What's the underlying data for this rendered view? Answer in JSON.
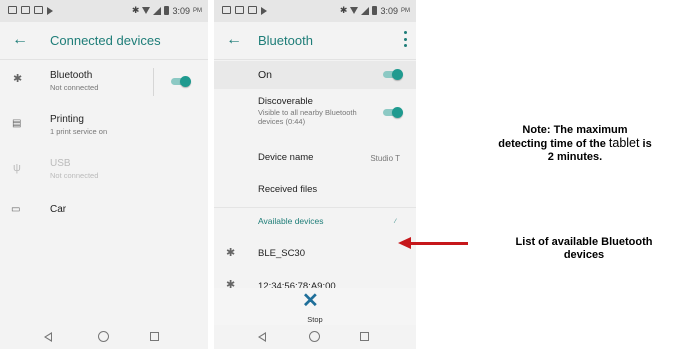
{
  "status_bar": {
    "time": "3:09",
    "ampm": "PM"
  },
  "screen1": {
    "title": "Connected devices",
    "items": [
      {
        "title": "Bluetooth",
        "subtitle": "Not connected",
        "icon": "bluetooth-icon",
        "toggle": true
      },
      {
        "title": "Printing",
        "subtitle": "1 print service on",
        "icon": "printer-icon"
      },
      {
        "title": "USB",
        "subtitle": "Not connected",
        "icon": "usb-icon",
        "disabled": true
      },
      {
        "title": "Car",
        "subtitle": "",
        "icon": "car-icon"
      }
    ]
  },
  "screen2": {
    "title": "Bluetooth",
    "on_label": "On",
    "discoverable_title": "Discoverable",
    "discoverable_sub": "Visible to all nearby Bluetooth devices (0:44)",
    "device_name_label": "Device name",
    "device_name_value": "Studio T",
    "received_files_label": "Received files",
    "available_devices_label": "Available devices",
    "devices": [
      "BLE_SC30",
      "12:34:56:78:A9:00"
    ],
    "stop_label": "Stop"
  },
  "notes": {
    "note1_line1": "Note: The maximum",
    "note1_line2_a": "detecting time of the ",
    "note1_line2_b": "tablet",
    "note1_line2_c": " is",
    "note1_line3": "2 minutes.",
    "note2_line1": "List of available Bluetooth",
    "note2_line2": "devices"
  },
  "colors": {
    "accent": "#1e7d78",
    "toggle": "#1f9a8f",
    "arrow": "#c6171b"
  }
}
